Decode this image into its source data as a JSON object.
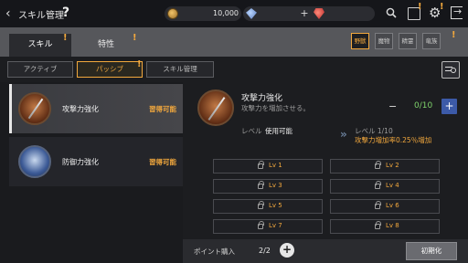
{
  "header": {
    "title": "スキル管理",
    "help": "?",
    "gold": "10,000",
    "crystal_plus": "+"
  },
  "main_tabs": [
    {
      "label": "スキル",
      "active": true
    },
    {
      "label": "特性",
      "active": false
    }
  ],
  "filter_tabs": [
    {
      "label": "野獣",
      "active": true
    },
    {
      "label": "魔物",
      "active": false
    },
    {
      "label": "精霊",
      "active": false
    },
    {
      "label": "竜族",
      "active": false
    }
  ],
  "sub_tabs": [
    {
      "label": "アクティブ",
      "active": false
    },
    {
      "label": "パッシブ",
      "active": true
    },
    {
      "label": "スキル管理",
      "active": false
    }
  ],
  "alert_mark": "!",
  "skills": [
    {
      "name": "攻撃力強化",
      "status": "習得可能",
      "selected": true
    },
    {
      "name": "防御力強化",
      "status": "習得可能",
      "selected": false
    }
  ],
  "detail": {
    "name": "攻撃力強化",
    "description": "攻撃力を増加させる。",
    "minus": "−",
    "count": "0/10",
    "plus": "+",
    "level_label": "レベル",
    "level_state": "使用可能",
    "next_level": "レベル  1/10",
    "effect": "攻撃力増加率0.25％増加"
  },
  "levels": [
    "Lv 1",
    "Lv 2",
    "Lv 3",
    "Lv 4",
    "Lv 5",
    "Lv 6",
    "Lv 7",
    "Lv 8"
  ],
  "footer": {
    "points_label": "ポイント購入",
    "points_value": "2/2",
    "plus": "+",
    "reset_label": "初期化"
  },
  "colors": {
    "accent": "#f2a83d",
    "available_green": "#7ed36b",
    "plus_blue": "#3c5aa8"
  },
  "icons": [
    "back-icon",
    "gold-coin-icon",
    "crystal-icon",
    "ruby-icon",
    "search-icon",
    "book-icon",
    "gear-icon",
    "exit-icon",
    "filter-search-icon",
    "lock-icon",
    "sword-icon",
    "shield-icon"
  ]
}
